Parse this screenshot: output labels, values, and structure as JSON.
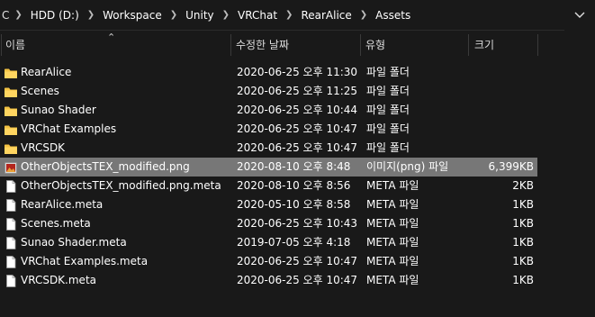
{
  "address_bar": {
    "crumbs": [
      "HDD (D:)",
      "Workspace",
      "Unity",
      "VRChat",
      "RearAlice",
      "Assets"
    ],
    "left_edge_text": "C"
  },
  "header": {
    "name": "이름",
    "modified": "수정한 날짜",
    "type": "유형",
    "size": "크기"
  },
  "files": [
    {
      "name": "RearAlice",
      "date": "2020-06-25 오후 11:30",
      "type": "파일 폴더",
      "size": "",
      "icon": "folder-icon",
      "selected": false
    },
    {
      "name": "Scenes",
      "date": "2020-06-25 오후 11:25",
      "type": "파일 폴더",
      "size": "",
      "icon": "folder-icon",
      "selected": false
    },
    {
      "name": "Sunao Shader",
      "date": "2020-06-25 오후 10:44",
      "type": "파일 폴더",
      "size": "",
      "icon": "folder-icon",
      "selected": false
    },
    {
      "name": "VRChat Examples",
      "date": "2020-06-25 오후 10:47",
      "type": "파일 폴더",
      "size": "",
      "icon": "folder-icon",
      "selected": false
    },
    {
      "name": "VRCSDK",
      "date": "2020-06-25 오후 10:47",
      "type": "파일 폴더",
      "size": "",
      "icon": "folder-icon",
      "selected": false
    },
    {
      "name": "OtherObjectsTEX_modified.png",
      "date": "2020-08-10 오후 8:48",
      "type": "이미지(png) 파일",
      "size": "6,399KB",
      "icon": "image-file-icon",
      "selected": true
    },
    {
      "name": "OtherObjectsTEX_modified.png.meta",
      "date": "2020-08-10 오후 8:56",
      "type": "META 파일",
      "size": "2KB",
      "icon": "file-icon",
      "selected": false
    },
    {
      "name": "RearAlice.meta",
      "date": "2020-05-10 오후 8:58",
      "type": "META 파일",
      "size": "1KB",
      "icon": "file-icon",
      "selected": false
    },
    {
      "name": "Scenes.meta",
      "date": "2020-06-25 오후 10:43",
      "type": "META 파일",
      "size": "1KB",
      "icon": "file-icon",
      "selected": false
    },
    {
      "name": "Sunao Shader.meta",
      "date": "2019-07-05 오후 4:18",
      "type": "META 파일",
      "size": "1KB",
      "icon": "file-icon",
      "selected": false
    },
    {
      "name": "VRChat Examples.meta",
      "date": "2020-06-25 오후 10:47",
      "type": "META 파일",
      "size": "1KB",
      "icon": "file-icon",
      "selected": false
    },
    {
      "name": "VRCSDK.meta",
      "date": "2020-06-25 오후 10:47",
      "type": "META 파일",
      "size": "1KB",
      "icon": "file-icon",
      "selected": false
    }
  ],
  "colors": {
    "background": "#191919",
    "selection": "#777777",
    "folder": "#f4c243"
  }
}
